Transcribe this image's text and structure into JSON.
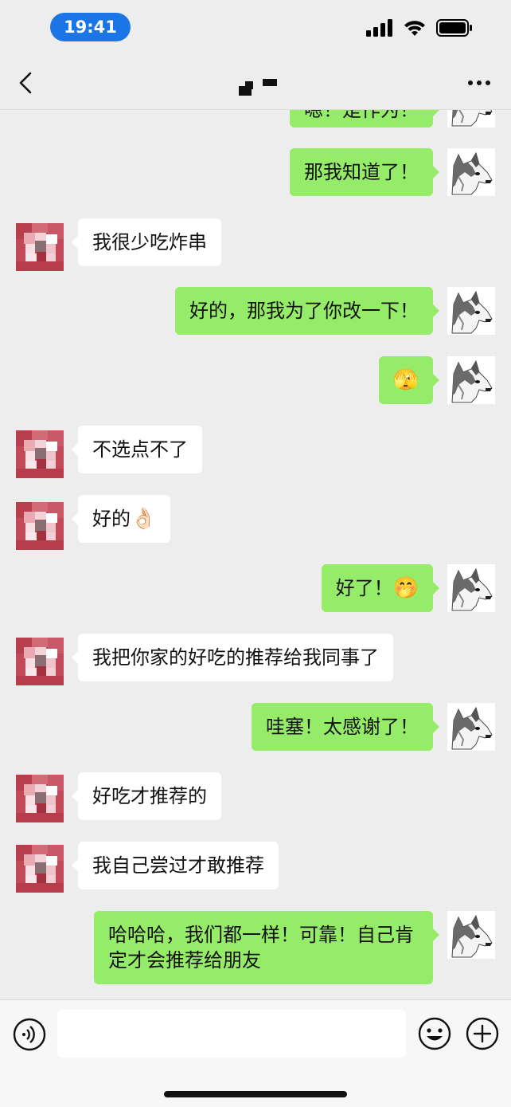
{
  "status_bar": {
    "time": "19:41"
  },
  "nav": {
    "title_icon": "pixelated-title-icon"
  },
  "messages": [
    {
      "side": "out",
      "text": "嗯！是作为！",
      "partial": true
    },
    {
      "side": "out",
      "text": "那我知道了！"
    },
    {
      "side": "in",
      "text": "我很少吃炸串"
    },
    {
      "side": "out",
      "text": "好的，那我为了你改一下！"
    },
    {
      "side": "out",
      "emoji": "🫣"
    },
    {
      "side": "in",
      "text": "不选点不了"
    },
    {
      "side": "in",
      "text": "好的",
      "emoji": "👌🏻"
    },
    {
      "side": "out",
      "text": "好了！",
      "emoji": "🤭"
    },
    {
      "side": "in",
      "text": "我把你家的好吃的推荐给我同事了"
    },
    {
      "side": "out",
      "text": "哇塞！太感谢了！"
    },
    {
      "side": "in",
      "text": "好吃才推荐的"
    },
    {
      "side": "in",
      "text": "我自己尝过才敢推荐"
    },
    {
      "side": "out",
      "text": "哈哈哈，我们都一样！可靠！自己肯定才会推荐给朋友"
    }
  ],
  "input_bar": {
    "placeholder": ""
  },
  "colors": {
    "out_bubble": "#95ec69",
    "in_bubble": "#ffffff",
    "background": "#ededed",
    "time_pill": "#1b75e6"
  }
}
